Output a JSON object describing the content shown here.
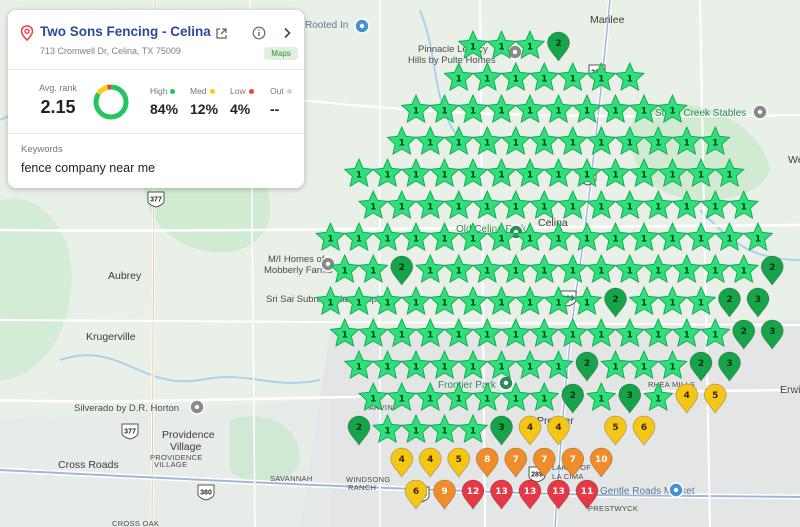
{
  "business": {
    "name": "Two Sons Fencing - Celina ...",
    "address": "713 Cromwell Dr, Celina, TX 75009",
    "source_badge": "Maps"
  },
  "stats": {
    "avg_rank_label": "Avg. rank",
    "avg_rank": "2.15",
    "high_label": "High",
    "high_value": "84%",
    "med_label": "Med",
    "med_value": "12%",
    "low_label": "Low",
    "low_value": "4%",
    "out_label": "Out",
    "out_value": "--",
    "high_fraction": 0.84,
    "med_fraction": 0.12,
    "low_fraction": 0.04
  },
  "keywords": {
    "label": "Keywords",
    "value": "fence company near me"
  },
  "colors": {
    "high": "#22c55e",
    "med": "#facc15",
    "low": "#ef4444",
    "out": "#d4d4d4",
    "rank1": "#2de07a",
    "rank2_3": "#16a34a",
    "rank4_6": "#f5c518",
    "rank7_10": "#f08c2a",
    "rank11_13": "#e53945",
    "water": "#a9d3ec",
    "park": "#bfe6c6"
  },
  "map": {
    "labels": [
      {
        "text": "Marilee",
        "cls": "big"
      },
      {
        "text": "Rooted In",
        "cls": "poi"
      },
      {
        "text": "Pinnacle Legacy",
        "cls": ""
      },
      {
        "text": "Hills by Pulte Homes",
        "cls": ""
      },
      {
        "text": "Stony Creek Stables",
        "cls": "poi2"
      },
      {
        "text": "Celina",
        "cls": "big"
      },
      {
        "text": "Old Celina Park",
        "cls": "poi2"
      },
      {
        "text": "Aubrey",
        "cls": "big"
      },
      {
        "text": "M/I Homes of",
        "cls": ""
      },
      {
        "text": "Mobberly Farms",
        "cls": ""
      },
      {
        "text": "Sri Sai Subramanian temple",
        "cls": ""
      },
      {
        "text": "Krugerville",
        "cls": "big"
      },
      {
        "text": "Silverado by D.R. Horton",
        "cls": ""
      },
      {
        "text": "Providence",
        "cls": "big"
      },
      {
        "text": "Village",
        "cls": "big"
      },
      {
        "text": "PROVIDENCE",
        "cls": "small"
      },
      {
        "text": "VILLAGE",
        "cls": "small"
      },
      {
        "text": "Cross Roads",
        "cls": "big"
      },
      {
        "text": "Frontier Park",
        "cls": "poi2"
      },
      {
        "text": "Prosper",
        "cls": "big"
      },
      {
        "text": "PARVIN",
        "cls": "small"
      },
      {
        "text": "RHEA MILLS",
        "cls": "small"
      },
      {
        "text": "SAVANNAH",
        "cls": "small"
      },
      {
        "text": "WINDSONG",
        "cls": "small"
      },
      {
        "text": "RANCH",
        "cls": "small"
      },
      {
        "text": "LAKES OF",
        "cls": "small"
      },
      {
        "text": "LA CIMA",
        "cls": "small"
      },
      {
        "text": "Gentle Roads Market",
        "cls": "poi"
      },
      {
        "text": "CROSS OAK",
        "cls": "small"
      },
      {
        "text": "PRESTWYCK",
        "cls": "small"
      },
      {
        "text": "Erwi",
        "cls": "big"
      },
      {
        "text": "We",
        "cls": "big"
      }
    ],
    "shields": [
      "377",
      "289",
      "289",
      "289",
      "377",
      "380",
      "380",
      "289"
    ],
    "grid_ranks": [
      [
        null,
        null,
        null,
        null,
        null,
        null,
        1,
        1,
        1,
        2,
        null,
        null,
        null,
        null,
        null,
        null,
        null
      ],
      [
        null,
        null,
        null,
        null,
        null,
        1,
        1,
        1,
        1,
        1,
        1,
        1,
        null,
        null,
        null,
        null,
        null
      ],
      [
        null,
        null,
        null,
        null,
        1,
        1,
        1,
        1,
        1,
        1,
        1,
        1,
        1,
        1,
        null,
        null,
        null
      ],
      [
        null,
        null,
        null,
        1,
        1,
        1,
        1,
        1,
        1,
        1,
        1,
        1,
        1,
        1,
        1,
        null,
        null
      ],
      [
        null,
        null,
        1,
        1,
        1,
        1,
        1,
        1,
        1,
        1,
        1,
        1,
        1,
        1,
        1,
        1,
        null
      ],
      [
        null,
        null,
        1,
        1,
        1,
        1,
        1,
        1,
        1,
        1,
        1,
        1,
        1,
        1,
        1,
        1,
        null
      ],
      [
        null,
        1,
        1,
        1,
        1,
        1,
        1,
        1,
        1,
        1,
        1,
        1,
        1,
        1,
        1,
        1,
        1
      ],
      [
        null,
        1,
        1,
        2,
        1,
        1,
        1,
        1,
        1,
        1,
        1,
        1,
        1,
        1,
        1,
        1,
        2
      ],
      [
        null,
        1,
        1,
        1,
        1,
        1,
        1,
        1,
        1,
        1,
        1,
        2,
        1,
        1,
        1,
        2,
        3
      ],
      [
        null,
        1,
        1,
        1,
        1,
        1,
        1,
        1,
        1,
        1,
        1,
        1,
        1,
        1,
        1,
        2,
        3
      ],
      [
        null,
        null,
        1,
        1,
        1,
        1,
        1,
        1,
        1,
        1,
        2,
        1,
        1,
        1,
        2,
        3,
        null
      ],
      [
        null,
        null,
        1,
        1,
        1,
        1,
        1,
        1,
        1,
        2,
        1,
        3,
        1,
        4,
        5,
        null,
        null
      ],
      [
        null,
        null,
        2,
        1,
        1,
        1,
        1,
        3,
        4,
        4,
        null,
        5,
        6,
        null,
        null,
        null,
        null
      ],
      [
        null,
        null,
        null,
        4,
        4,
        5,
        8,
        7,
        7,
        7,
        10,
        null,
        null,
        null,
        null,
        null,
        null
      ],
      [
        null,
        null,
        null,
        null,
        6,
        9,
        12,
        13,
        13,
        13,
        11,
        null,
        null,
        null,
        null,
        null,
        null
      ]
    ]
  }
}
